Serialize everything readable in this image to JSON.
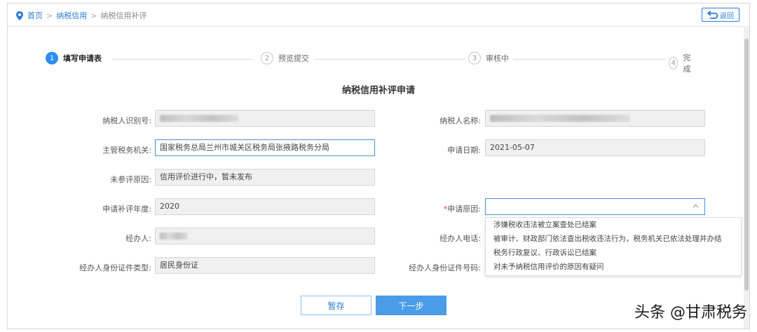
{
  "breadcrumb": {
    "home": "首页",
    "level2": "纳税信用",
    "current": "纳税信用补评",
    "separator": ">"
  },
  "back_label": "返回",
  "steps": [
    {
      "index": "1",
      "label": "填写申请表",
      "active": true
    },
    {
      "index": "2",
      "label": "预览提交",
      "active": false
    },
    {
      "index": "3",
      "label": "审核中",
      "active": false
    },
    {
      "index": "4",
      "label": "完成",
      "active": false
    }
  ],
  "form": {
    "title": "纳税信用补评申请",
    "taxpayer_id_label": "纳税人识别号:",
    "taxpayer_name_label": "纳税人名称:",
    "tax_authority_label": "主管税务机关:",
    "tax_authority_value": "国家税务总局兰州市城关区税务局张掖路税务分局",
    "apply_date_label": "申请日期:",
    "apply_date_value": "2021-05-07",
    "not_rated_reason_label": "未参评原因:",
    "not_rated_reason_value": "信用评价进行中，暂未发布",
    "apply_year_label": "申请补评年度:",
    "apply_year_value": "2020",
    "apply_reason_required": "*",
    "apply_reason_label": "申请原因:",
    "handler_label": "经办人:",
    "handler_phone_label": "经办人电话:",
    "handler_id_type_label": "经办人身份证件类型:",
    "handler_id_type_value": "居民身份证",
    "handler_id_number_label": "经办人身份证件号码:"
  },
  "reason_options": [
    "涉嫌税收违法被立案查处已结案",
    "被审计、财政部门依法查出税收违法行为，税务机关已依法处理并办结",
    "税务行政复议、行政诉讼已结案",
    "对未予纳税信用评价的原因有疑问"
  ],
  "buttons": {
    "save": "暂存",
    "next": "下一步"
  },
  "watermark": "头条 @甘肃税务",
  "colors": {
    "accent": "#2b8ef0",
    "link": "#2b7cd3",
    "primary_button": "#4a9be8"
  }
}
